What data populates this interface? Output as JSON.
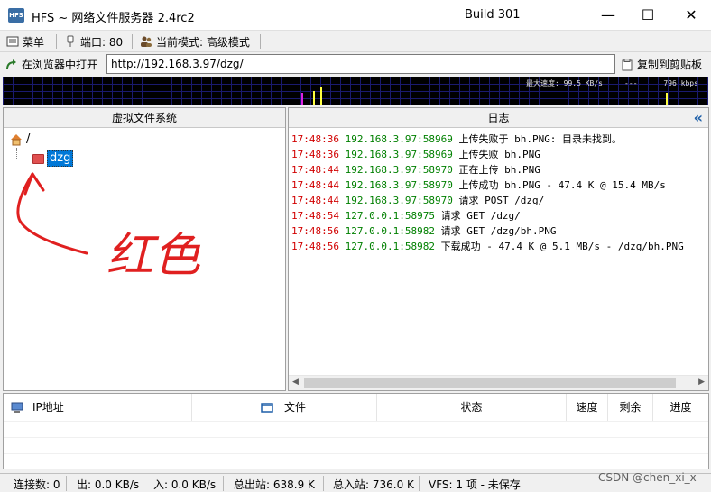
{
  "window": {
    "title": "HFS ~ 网络文件服务器 2.4rc2",
    "build": "Build 301",
    "logo": "HFS",
    "controls": {
      "minimize": "—",
      "maximize": "☐",
      "close": "✕"
    }
  },
  "menubar": {
    "menu_label": "菜单",
    "port_label": "端口: 80",
    "mode_label": "当前模式: 高级模式"
  },
  "urlbar": {
    "open_browser_label": "在浏览器中打开",
    "url_value": "http://192.168.3.97/dzg/",
    "copy_label": "复制到剪贴板"
  },
  "graph": {
    "speed_text": "最大速度: 99.5 KB/s     ---      796 kbps"
  },
  "vfs": {
    "title": "虚拟文件系统",
    "root": "/",
    "folder": "dzg",
    "folder_color": "#e05050"
  },
  "log": {
    "title": "日志",
    "collapse": "«",
    "lines": [
      {
        "time": "17:48:36",
        "addr": "192.168.3.97:58969",
        "msg": "上传失败于 bh.PNG: 目录未找到。"
      },
      {
        "time": "17:48:36",
        "addr": "192.168.3.97:58969",
        "msg": "上传失败 bh.PNG"
      },
      {
        "time": "17:48:44",
        "addr": "192.168.3.97:58970",
        "msg": "正在上传 bh.PNG"
      },
      {
        "time": "17:48:44",
        "addr": "192.168.3.97:58970",
        "msg": "上传成功 bh.PNG - 47.4 K @ 15.4 MB/s"
      },
      {
        "time": "17:48:44",
        "addr": "192.168.3.97:58970",
        "msg": "请求 POST /dzg/"
      },
      {
        "time": "17:48:54",
        "addr": "127.0.0.1:58975",
        "msg": "请求 GET /dzg/"
      },
      {
        "time": "17:48:56",
        "addr": "127.0.0.1:58982",
        "msg": "请求 GET /dzg/bh.PNG"
      },
      {
        "time": "17:48:56",
        "addr": "127.0.0.1:58982",
        "msg": "下载成功 - 47.4 K @ 5.1 MB/s - /dzg/bh.PNG"
      }
    ],
    "colors": {
      "time": "#d10000",
      "addr": "#008000"
    }
  },
  "transfers": {
    "columns": [
      "IP地址",
      "文件",
      "状态",
      "速度",
      "剩余",
      "进度"
    ]
  },
  "statusbar": {
    "connections": "连接数: 0",
    "out_speed": "出: 0.0 KB/s",
    "in_speed": "入: 0.0 KB/s",
    "total_out": "总出站: 638.9 K",
    "total_in": "总入站: 736.0 K",
    "vfs": "VFS: 1 项 - 未保存"
  },
  "annotation": {
    "text": "红色",
    "color": "#e02020"
  },
  "watermark": "CSDN @chen_xi_x"
}
